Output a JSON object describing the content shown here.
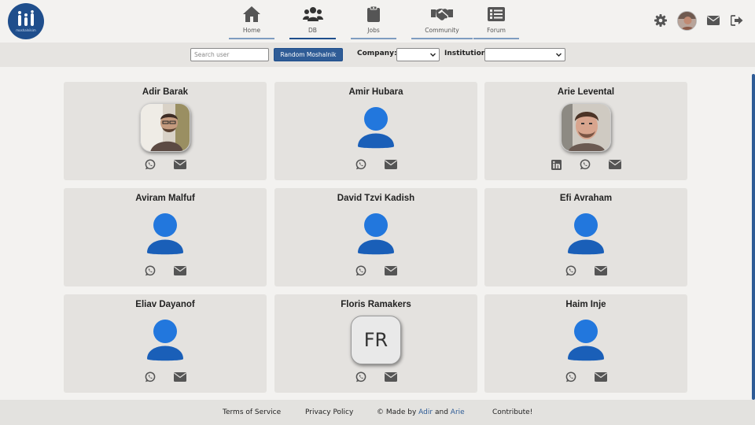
{
  "app": {
    "logo_text": "moshalnikim"
  },
  "nav": {
    "tabs": [
      {
        "label": "Home",
        "icon": "home-icon"
      },
      {
        "label": "DB",
        "icon": "users-icon",
        "active": true
      },
      {
        "label": "Jobs",
        "icon": "clipboard-icon"
      },
      {
        "label": "Community",
        "icon": "handshake-icon"
      },
      {
        "label": "Forum",
        "icon": "list-icon"
      }
    ],
    "right_icons": [
      "gear-icon",
      "avatar",
      "envelope-icon",
      "logout-icon"
    ]
  },
  "filters": {
    "search_placeholder": "Search user",
    "random_button": "Random Moshalnik",
    "company_label": "Company:",
    "company_value": "",
    "institution_label": "Institution:",
    "institution_value": ""
  },
  "users": [
    {
      "name": "Adir Barak",
      "avatar": "photo",
      "links": [
        "whatsapp",
        "email"
      ]
    },
    {
      "name": "Amir Hubara",
      "avatar": "default",
      "links": [
        "whatsapp",
        "email"
      ]
    },
    {
      "name": "Arie Levental",
      "avatar": "photo",
      "links": [
        "linkedin",
        "whatsapp",
        "email"
      ]
    },
    {
      "name": "Aviram Malfuf",
      "avatar": "default",
      "links": [
        "whatsapp",
        "email"
      ]
    },
    {
      "name": "David Tzvi Kadish",
      "avatar": "default",
      "links": [
        "whatsapp",
        "email"
      ]
    },
    {
      "name": "Efi Avraham",
      "avatar": "default",
      "links": [
        "whatsapp",
        "email"
      ]
    },
    {
      "name": "Eliav Dayanof",
      "avatar": "default",
      "links": [
        "whatsapp",
        "email"
      ]
    },
    {
      "name": "Floris Ramakers",
      "avatar": "initials",
      "initials": "FR",
      "links": [
        "whatsapp",
        "email"
      ]
    },
    {
      "name": "Haim Inje",
      "avatar": "default",
      "links": [
        "whatsapp",
        "email"
      ]
    }
  ],
  "footer": {
    "terms": "Terms of Service",
    "privacy": "Privacy Policy",
    "made_by_prefix": "© Made by",
    "author1": "Adir",
    "and": "and",
    "author2": "Arie",
    "contribute": "Contribute!"
  },
  "colors": {
    "brand": "#1f4e8c",
    "accent_blue": "#2277dd",
    "icon_gray": "#555555"
  }
}
